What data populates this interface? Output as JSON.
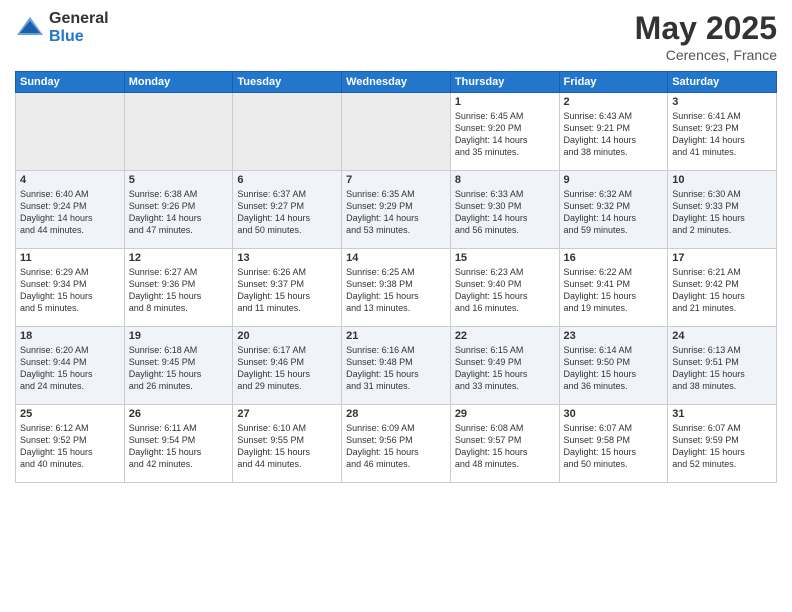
{
  "logo": {
    "general": "General",
    "blue": "Blue"
  },
  "header": {
    "month": "May 2025",
    "location": "Cerences, France"
  },
  "days_of_week": [
    "Sunday",
    "Monday",
    "Tuesday",
    "Wednesday",
    "Thursday",
    "Friday",
    "Saturday"
  ],
  "weeks": [
    [
      {
        "num": "",
        "info": ""
      },
      {
        "num": "",
        "info": ""
      },
      {
        "num": "",
        "info": ""
      },
      {
        "num": "",
        "info": ""
      },
      {
        "num": "1",
        "info": "Sunrise: 6:45 AM\nSunset: 9:20 PM\nDaylight: 14 hours\nand 35 minutes."
      },
      {
        "num": "2",
        "info": "Sunrise: 6:43 AM\nSunset: 9:21 PM\nDaylight: 14 hours\nand 38 minutes."
      },
      {
        "num": "3",
        "info": "Sunrise: 6:41 AM\nSunset: 9:23 PM\nDaylight: 14 hours\nand 41 minutes."
      }
    ],
    [
      {
        "num": "4",
        "info": "Sunrise: 6:40 AM\nSunset: 9:24 PM\nDaylight: 14 hours\nand 44 minutes."
      },
      {
        "num": "5",
        "info": "Sunrise: 6:38 AM\nSunset: 9:26 PM\nDaylight: 14 hours\nand 47 minutes."
      },
      {
        "num": "6",
        "info": "Sunrise: 6:37 AM\nSunset: 9:27 PM\nDaylight: 14 hours\nand 50 minutes."
      },
      {
        "num": "7",
        "info": "Sunrise: 6:35 AM\nSunset: 9:29 PM\nDaylight: 14 hours\nand 53 minutes."
      },
      {
        "num": "8",
        "info": "Sunrise: 6:33 AM\nSunset: 9:30 PM\nDaylight: 14 hours\nand 56 minutes."
      },
      {
        "num": "9",
        "info": "Sunrise: 6:32 AM\nSunset: 9:32 PM\nDaylight: 14 hours\nand 59 minutes."
      },
      {
        "num": "10",
        "info": "Sunrise: 6:30 AM\nSunset: 9:33 PM\nDaylight: 15 hours\nand 2 minutes."
      }
    ],
    [
      {
        "num": "11",
        "info": "Sunrise: 6:29 AM\nSunset: 9:34 PM\nDaylight: 15 hours\nand 5 minutes."
      },
      {
        "num": "12",
        "info": "Sunrise: 6:27 AM\nSunset: 9:36 PM\nDaylight: 15 hours\nand 8 minutes."
      },
      {
        "num": "13",
        "info": "Sunrise: 6:26 AM\nSunset: 9:37 PM\nDaylight: 15 hours\nand 11 minutes."
      },
      {
        "num": "14",
        "info": "Sunrise: 6:25 AM\nSunset: 9:38 PM\nDaylight: 15 hours\nand 13 minutes."
      },
      {
        "num": "15",
        "info": "Sunrise: 6:23 AM\nSunset: 9:40 PM\nDaylight: 15 hours\nand 16 minutes."
      },
      {
        "num": "16",
        "info": "Sunrise: 6:22 AM\nSunset: 9:41 PM\nDaylight: 15 hours\nand 19 minutes."
      },
      {
        "num": "17",
        "info": "Sunrise: 6:21 AM\nSunset: 9:42 PM\nDaylight: 15 hours\nand 21 minutes."
      }
    ],
    [
      {
        "num": "18",
        "info": "Sunrise: 6:20 AM\nSunset: 9:44 PM\nDaylight: 15 hours\nand 24 minutes."
      },
      {
        "num": "19",
        "info": "Sunrise: 6:18 AM\nSunset: 9:45 PM\nDaylight: 15 hours\nand 26 minutes."
      },
      {
        "num": "20",
        "info": "Sunrise: 6:17 AM\nSunset: 9:46 PM\nDaylight: 15 hours\nand 29 minutes."
      },
      {
        "num": "21",
        "info": "Sunrise: 6:16 AM\nSunset: 9:48 PM\nDaylight: 15 hours\nand 31 minutes."
      },
      {
        "num": "22",
        "info": "Sunrise: 6:15 AM\nSunset: 9:49 PM\nDaylight: 15 hours\nand 33 minutes."
      },
      {
        "num": "23",
        "info": "Sunrise: 6:14 AM\nSunset: 9:50 PM\nDaylight: 15 hours\nand 36 minutes."
      },
      {
        "num": "24",
        "info": "Sunrise: 6:13 AM\nSunset: 9:51 PM\nDaylight: 15 hours\nand 38 minutes."
      }
    ],
    [
      {
        "num": "25",
        "info": "Sunrise: 6:12 AM\nSunset: 9:52 PM\nDaylight: 15 hours\nand 40 minutes."
      },
      {
        "num": "26",
        "info": "Sunrise: 6:11 AM\nSunset: 9:54 PM\nDaylight: 15 hours\nand 42 minutes."
      },
      {
        "num": "27",
        "info": "Sunrise: 6:10 AM\nSunset: 9:55 PM\nDaylight: 15 hours\nand 44 minutes."
      },
      {
        "num": "28",
        "info": "Sunrise: 6:09 AM\nSunset: 9:56 PM\nDaylight: 15 hours\nand 46 minutes."
      },
      {
        "num": "29",
        "info": "Sunrise: 6:08 AM\nSunset: 9:57 PM\nDaylight: 15 hours\nand 48 minutes."
      },
      {
        "num": "30",
        "info": "Sunrise: 6:07 AM\nSunset: 9:58 PM\nDaylight: 15 hours\nand 50 minutes."
      },
      {
        "num": "31",
        "info": "Sunrise: 6:07 AM\nSunset: 9:59 PM\nDaylight: 15 hours\nand 52 minutes."
      }
    ]
  ]
}
